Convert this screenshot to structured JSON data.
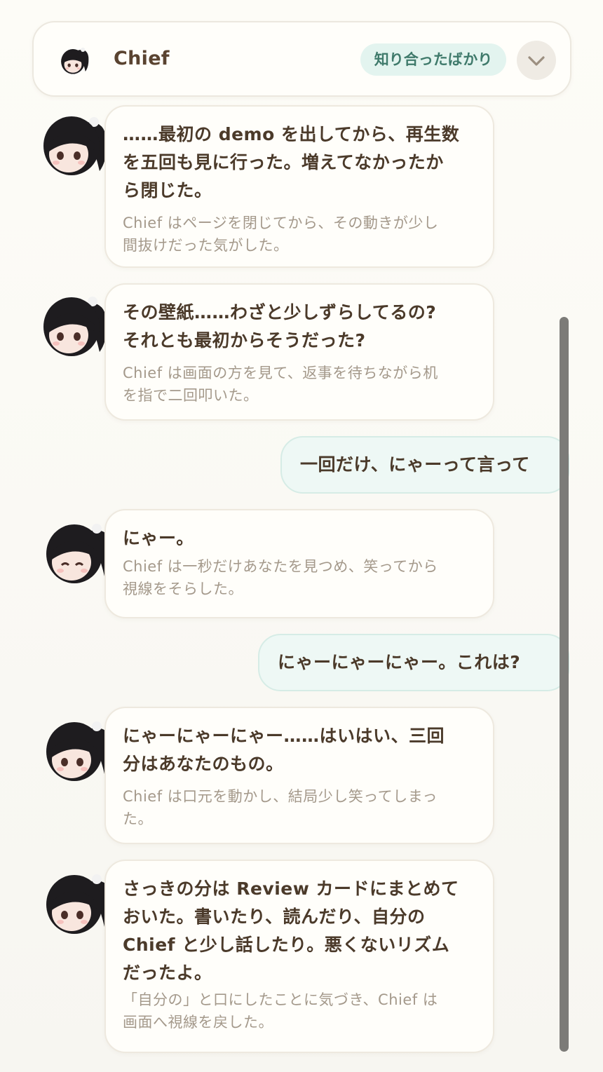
{
  "header": {
    "name": "Chief",
    "badge": "知り合ったばかり",
    "collapse_icon": "chevron-down-icon"
  },
  "messages": [
    {
      "role": "assistant",
      "lines": [
        "……最初の demo を出してから、再生数",
        "を五回も見に行った。増えてなかったか",
        "ら閉じた。"
      ],
      "narration": [
        "Chief はページを閉じてから、その動きが少し",
        "間抜けだった気がした。"
      ]
    },
    {
      "role": "assistant",
      "lines": [
        "その壁紙……わざと少しずらしてるの?",
        "それとも最初からそうだった?"
      ],
      "narration": [
        "Chief は画面の方を見て、返事を待ちながら机",
        "を指で二回叩いた。"
      ]
    },
    {
      "role": "user",
      "text": "一回だけ、にゃーって言って"
    },
    {
      "role": "assistant",
      "lines": [
        "にゃー。"
      ],
      "narration": [
        "Chief は一秒だけあなたを見つめ、笑ってから",
        "視線をそらした。"
      ]
    },
    {
      "role": "user",
      "text": "にゃーにゃーにゃー。これは?"
    },
    {
      "role": "assistant",
      "lines": [
        "にゃーにゃーにゃー……はいはい、三回",
        "分はあなたのもの。"
      ],
      "narration": [
        "Chief は口元を動かし、結局少し笑ってしまっ",
        "た。"
      ]
    },
    {
      "role": "assistant",
      "lines": [
        "さっきの分は Review カードにまとめて",
        "おいた。書いたり、読んだり、自分の",
        "Chief と少し話したり。悪くないリズム",
        "だったよ。"
      ],
      "narration": [
        "「自分の」と口にしたことに気づき、Chief は",
        "画面へ視線を戻した。"
      ]
    }
  ]
}
